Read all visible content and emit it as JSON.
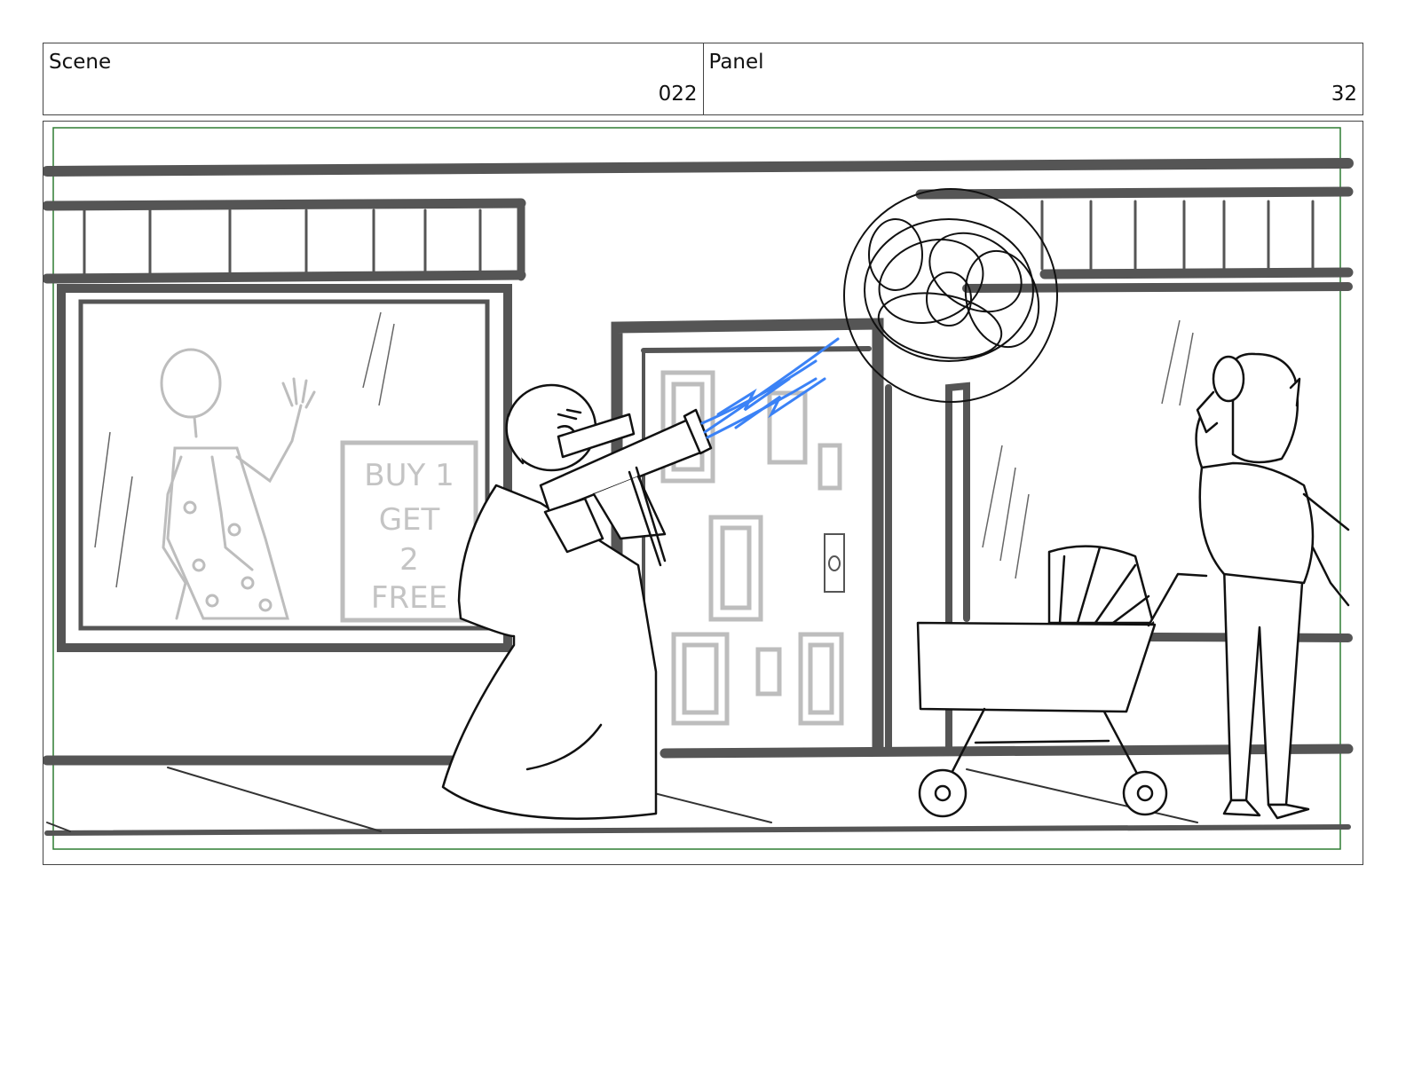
{
  "header": {
    "scene_label": "Scene",
    "scene_value": "022",
    "panel_label": "Panel",
    "panel_value": "32"
  },
  "drawing": {
    "sign_text": [
      "BUY 1",
      "GET",
      "2",
      "FREE"
    ],
    "safe_area_color": "#2e7d32",
    "line_color": "#555555",
    "sketch_color": "#111111",
    "faint_color": "#bdbdbd",
    "water_color": "#3b82f6"
  }
}
